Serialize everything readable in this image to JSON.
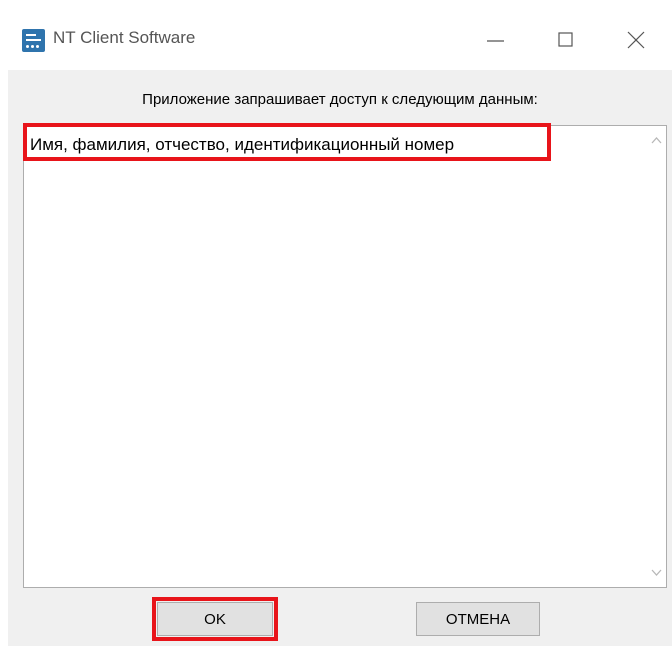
{
  "window": {
    "title": "NT Client Software",
    "app_icon": "app-logo-icon",
    "controls": {
      "minimize_icon": "minimize-icon",
      "maximize_icon": "maximize-icon",
      "close_icon": "close-icon"
    }
  },
  "dialog": {
    "prompt": "Приложение запрашивает доступ к следующим данным:",
    "items": [
      "Имя, фамилия, отчество, идентификационный номер"
    ],
    "highlight_color": "#e8141a"
  },
  "buttons": {
    "ok_label": "OK",
    "cancel_label": "ОТМЕНА"
  }
}
